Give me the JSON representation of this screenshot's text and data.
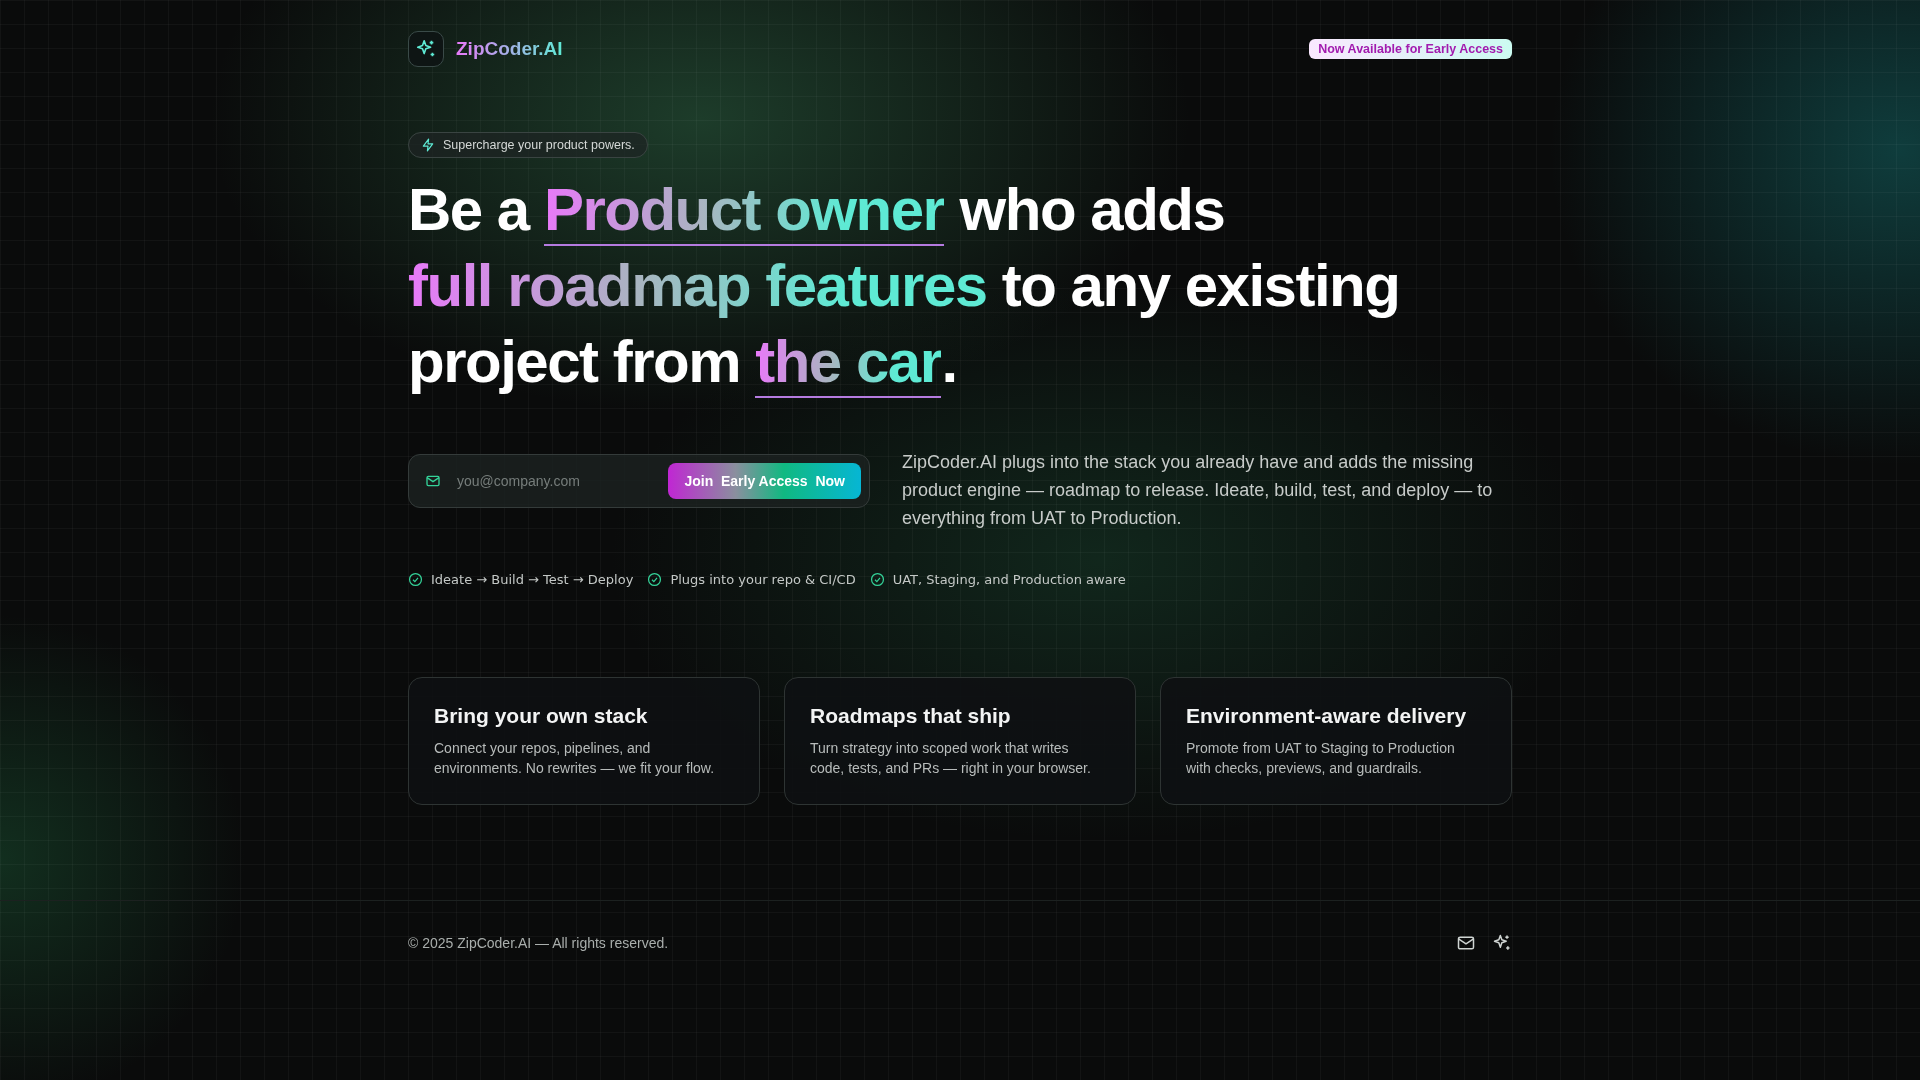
{
  "brand": {
    "name": "ZipCoder.AI"
  },
  "announcement": "Now Available for Early Access",
  "tagline": "Supercharge your product powers.",
  "headline": [
    [
      {
        "text": "Be a ",
        "kind": "plain",
        "underline": false
      },
      {
        "text": "Product owner",
        "kind": "gradient",
        "underline": true
      },
      {
        "text": " who adds",
        "kind": "plain",
        "underline": false
      }
    ],
    [
      {
        "text": "full roadmap features",
        "kind": "gradient",
        "underline": false
      },
      {
        "text": " to any existing",
        "kind": "plain",
        "underline": false
      }
    ],
    [
      {
        "text": "project from ",
        "kind": "plain",
        "underline": false
      },
      {
        "text": "the car",
        "kind": "gradient",
        "underline": true
      },
      {
        "text": ".",
        "kind": "plain",
        "underline": false
      }
    ]
  ],
  "signup": {
    "placeholder": "you@company.com",
    "button": "Join  Early Access  Now"
  },
  "description": "ZipCoder.AI plugs into the stack you already have and adds the missing product engine — roadmap to release. Ideate, build, test, and deploy — to everything from UAT to Production.",
  "checks": [
    "Ideate → Build → Test → Deploy",
    "Plugs into your repo & CI/CD",
    "UAT, Staging, and Production aware"
  ],
  "cards": [
    {
      "title": "Bring your own stack",
      "body": "Connect your repos, pipelines, and environments. No rewrites — we fit your flow."
    },
    {
      "title": "Roadmaps that ship",
      "body": "Turn strategy into scoped work that writes code, tests, and PRs — right in your browser."
    },
    {
      "title": "Environment-aware delivery",
      "body": "Promote from UAT to Staging to Production with checks, previews, and guardrails."
    }
  ],
  "footer": {
    "copyright": "© 2025 ZipCoder.AI — All rights reserved."
  }
}
